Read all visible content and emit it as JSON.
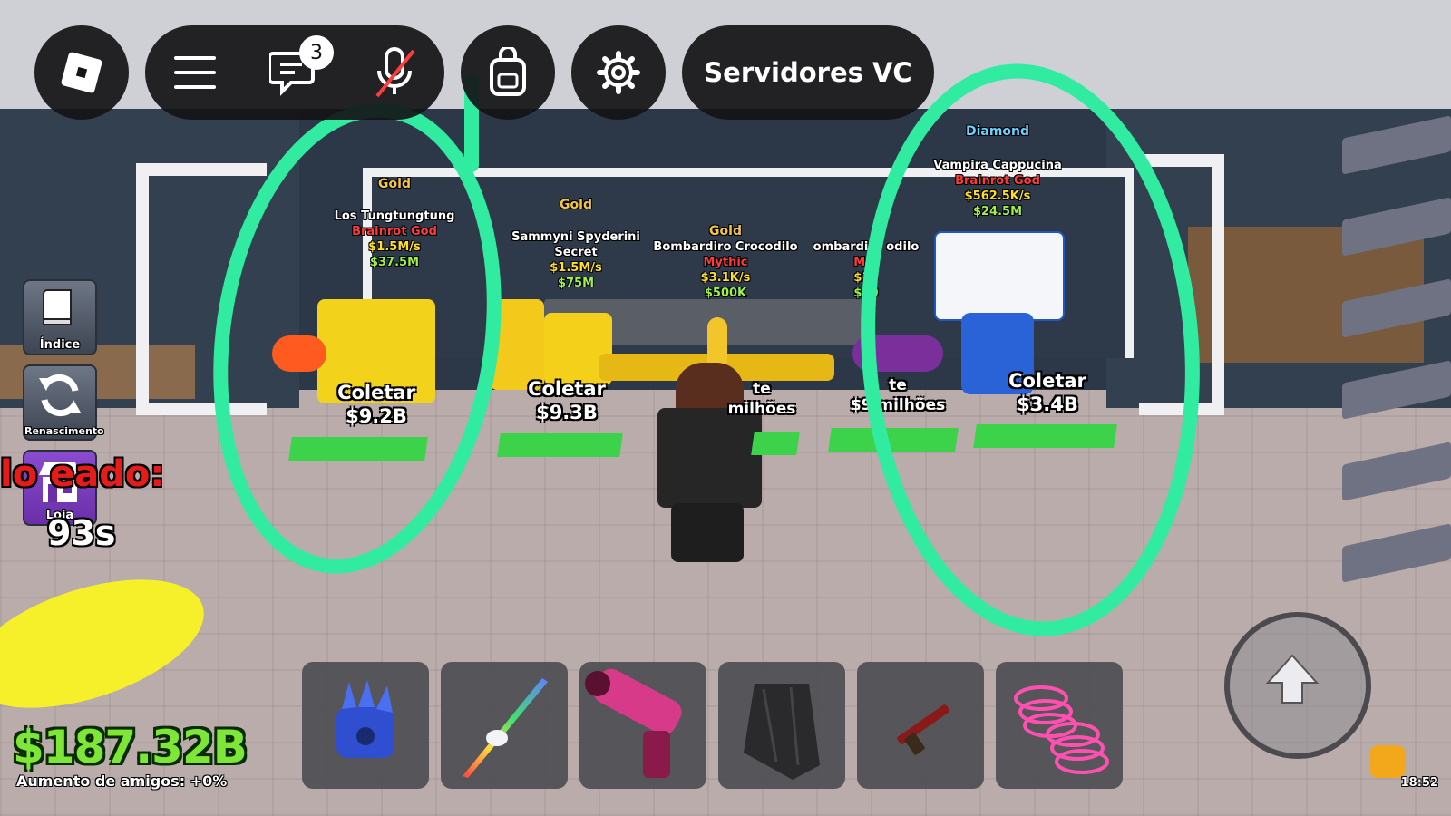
{
  "topbar": {
    "chat_badge": "3",
    "servers_label": "Servidores VC"
  },
  "sidebar": {
    "index_label": "Índice",
    "rebirth_label": "Renascimento",
    "shop_label": "Loja"
  },
  "event": {
    "banner_text": "lo eado:",
    "timer": "93s"
  },
  "brainrots": [
    {
      "rarity": "Gold",
      "name": "Los Tungtungtung",
      "tier": "Brainrot God",
      "rate": "$1.5M/s",
      "worth": "$37.5M",
      "collect_label": "Coletar",
      "collect_value": "$9.2B"
    },
    {
      "rarity": "Gold",
      "name": "Sammyni Spyderini",
      "tier": "Secret",
      "rate": "$1.5M/s",
      "worth": "$75M",
      "collect_label": "Coletar",
      "collect_value": "$9.3B"
    },
    {
      "rarity": "Gold",
      "name": "Bombardiro Crocodilo",
      "tier": "Mythic",
      "rate": "$3.1K/s",
      "worth": "$500K",
      "collect_label": "te",
      "collect_value": "milhões"
    },
    {
      "rarity": "",
      "name": "ombardiro odilo",
      "tier": "Myt",
      "rate": "$15",
      "worth": "$50",
      "collect_label": "te",
      "collect_value": "$9 milhões"
    },
    {
      "rarity": "Diamond",
      "name": "Vampira Cappucina",
      "tier": "Brainrot God",
      "rate": "$562.5K/s",
      "worth": "$24.5M",
      "collect_label": "Coletar",
      "collect_value": "$3.4B"
    }
  ],
  "hotbar": [
    "power-glove-icon",
    "unicorn-sword-icon",
    "blaster-cannon-icon",
    "cloak-icon",
    "rifle-icon",
    "spring-coil-icon"
  ],
  "player": {
    "money": "$187.32B",
    "friends_boost": "Aumento de amigos: +0%"
  },
  "status": {
    "time": "18:52"
  },
  "colors": {
    "annotation": "#31eba0",
    "money": "#7de637",
    "pad": "#3cd24a"
  }
}
